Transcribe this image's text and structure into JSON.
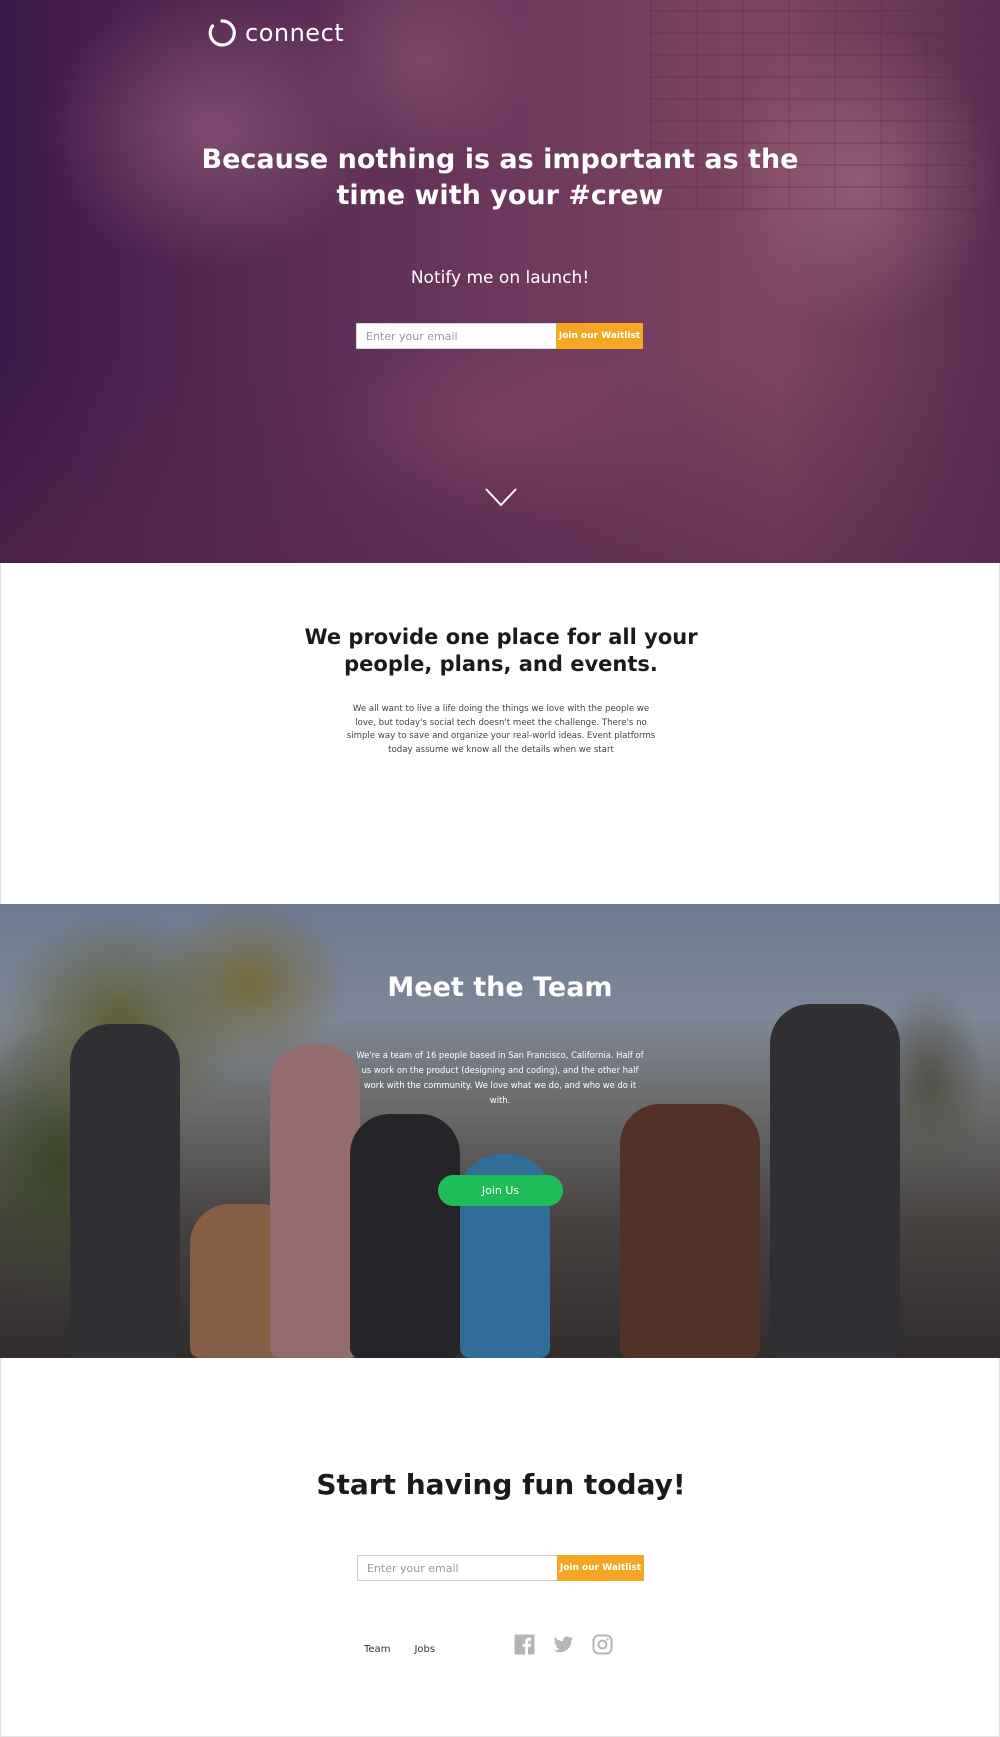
{
  "brand": {
    "name": "connect"
  },
  "hero": {
    "title": "Because nothing is as important as the time with your #crew",
    "notify_text": "Notify me on launch!",
    "email_placeholder": "Enter your email",
    "join_button": "Join our Waitlist",
    "scroll_icon": "chevron-down-icon"
  },
  "provide": {
    "title": "We provide one place for all your people, plans, and events.",
    "body": "We all want to live a life doing the things we love with the people we love, but today's social tech doesn't meet the challenge. There's no simple way to save and organize your real-world ideas. Event platforms today assume we know all the details when we start"
  },
  "team": {
    "title": "Meet the Team",
    "body": "We're a team of 16 people based in San Francisco, California. Half of us work on the product (designing and coding), and the other half work with the community. We love what we do, and who we do it with.",
    "join_button": "Join Us"
  },
  "fun": {
    "title": "Start having fun today!",
    "email_placeholder": "Enter your email",
    "join_button": "Join our Waitlist"
  },
  "footer": {
    "links": [
      "Team",
      "Jobs"
    ],
    "social_icons": [
      "facebook-icon",
      "twitter-icon",
      "instagram-icon"
    ]
  },
  "colors": {
    "accent_orange": "#f5a623",
    "join_green": "#1fbd5a",
    "hero_overlay": "#3c1d4a",
    "social_gray": "#b5b5b5"
  }
}
